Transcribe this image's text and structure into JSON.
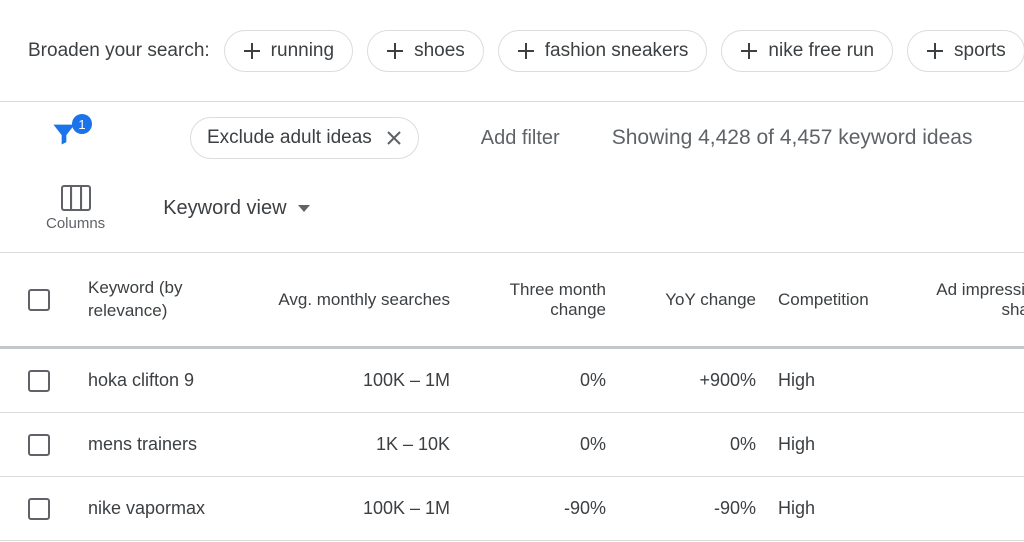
{
  "broaden": {
    "label": "Broaden your search:",
    "chips": [
      "running",
      "shoes",
      "fashion sneakers",
      "nike free run",
      "sports"
    ]
  },
  "filter": {
    "badge": "1",
    "applied_label": "Exclude adult ideas",
    "add_filter": "Add filter",
    "showing": "Showing 4,428 of 4,457 keyword ideas"
  },
  "toolbar": {
    "columns_label": "Columns",
    "view_label": "Keyword view"
  },
  "table": {
    "headers": {
      "keyword": "Keyword (by relevance)",
      "avg": "Avg. monthly searches",
      "three_month": "Three month change",
      "yoy": "YoY change",
      "competition": "Competition",
      "ad_impr": "Ad impression share"
    },
    "rows": [
      {
        "keyword": "hoka clifton 9",
        "avg": "100K – 1M",
        "three_month": "0%",
        "yoy": "+900%",
        "competition": "High"
      },
      {
        "keyword": "mens trainers",
        "avg": "1K – 10K",
        "three_month": "0%",
        "yoy": "0%",
        "competition": "High"
      },
      {
        "keyword": "nike vapormax",
        "avg": "100K – 1M",
        "three_month": "-90%",
        "yoy": "-90%",
        "competition": "High"
      }
    ]
  }
}
